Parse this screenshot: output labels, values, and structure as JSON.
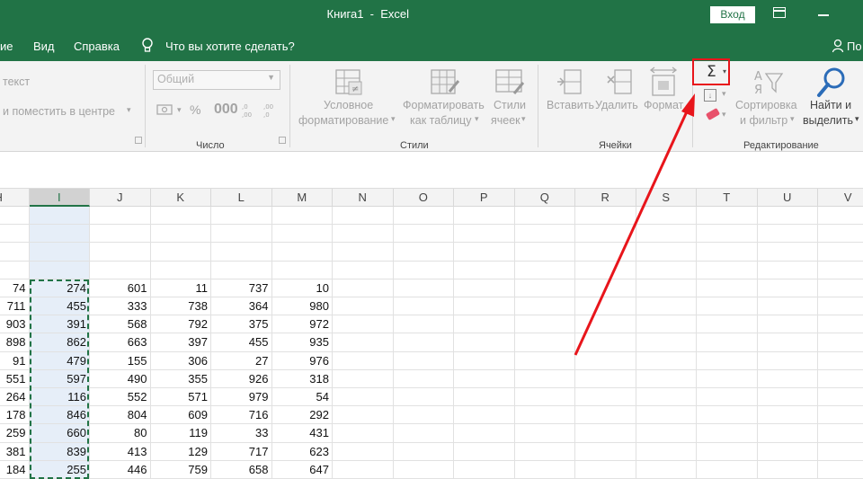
{
  "titlebar": {
    "title": "Книга1  -  Excel",
    "signin_label": "Вход"
  },
  "menubar": {
    "items": [
      "ие",
      "Вид",
      "Справка"
    ],
    "tell_me": "Что вы хотите сделать?",
    "share": "По"
  },
  "ribbon": {
    "alignment": {
      "wrap_text": "текст",
      "merge_center": "и поместить в центре"
    },
    "number": {
      "format": "Общий",
      "group_label": "Число"
    },
    "styles": {
      "conditional": [
        "Условное",
        "форматирование"
      ],
      "format_table": [
        "Форматировать",
        "как таблицу"
      ],
      "cell_styles": [
        "Стили",
        "ячеек"
      ],
      "group_label": "Стили"
    },
    "cells": {
      "insert": "Вставить",
      "delete": "Удалить",
      "format": "Формат",
      "group_label": "Ячейки"
    },
    "editing": {
      "autosum_symbol": "Σ",
      "sort": [
        "Сортировка",
        "и фильтр"
      ],
      "find": [
        "Найти и",
        "выделить"
      ],
      "group_label": "Редактирование"
    }
  },
  "sheet": {
    "columns": [
      "H",
      "I",
      "J",
      "K",
      "L",
      "M",
      "N",
      "O",
      "P",
      "Q",
      "R",
      "S",
      "T",
      "U",
      "V"
    ],
    "selected_column": "I",
    "rows": [
      [
        "74",
        "274",
        "601",
        "11",
        "737",
        "10"
      ],
      [
        "711",
        "455",
        "333",
        "738",
        "364",
        "980"
      ],
      [
        "903",
        "391",
        "568",
        "792",
        "375",
        "972"
      ],
      [
        "898",
        "862",
        "663",
        "397",
        "455",
        "935"
      ],
      [
        "91",
        "479",
        "155",
        "306",
        "27",
        "976"
      ],
      [
        "551",
        "597",
        "490",
        "355",
        "926",
        "318"
      ],
      [
        "264",
        "116",
        "552",
        "571",
        "979",
        "54"
      ],
      [
        "178",
        "846",
        "804",
        "609",
        "716",
        "292"
      ],
      [
        "259",
        "660",
        "80",
        "119",
        "33",
        "431"
      ],
      [
        "381",
        "839",
        "413",
        "129",
        "717",
        "623"
      ],
      [
        "184",
        "255",
        "446",
        "759",
        "658",
        "647"
      ]
    ]
  },
  "colors": {
    "excel_green": "#217346",
    "highlight_red": "#e8151b"
  }
}
